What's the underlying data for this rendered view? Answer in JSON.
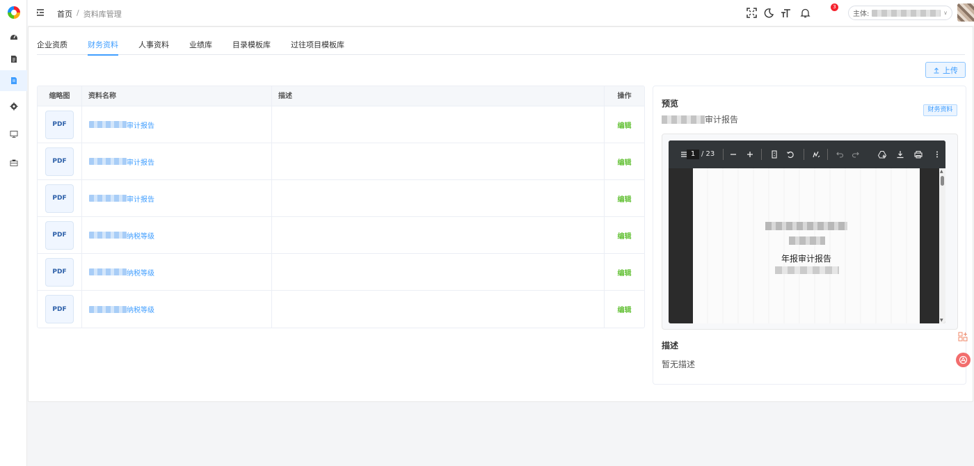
{
  "header": {
    "breadcrumb": {
      "home": "首页",
      "separator": "/",
      "current": "资料库管理"
    },
    "notification_count": "3",
    "entity_label": "主体:"
  },
  "tabs": [
    {
      "label": "企业资质",
      "active": false
    },
    {
      "label": "财务资料",
      "active": true
    },
    {
      "label": "人事资料",
      "active": false
    },
    {
      "label": "业绩库",
      "active": false
    },
    {
      "label": "目录模板库",
      "active": false
    },
    {
      "label": "过往项目模板库",
      "active": false
    }
  ],
  "upload_label": "上传",
  "table": {
    "headers": {
      "thumb": "缩略图",
      "name": "资料名称",
      "desc": "描述",
      "op": "操作"
    },
    "rows": [
      {
        "thumb": "PDF",
        "name_suffix": "审计报告",
        "desc": "",
        "op": "编辑"
      },
      {
        "thumb": "PDF",
        "name_suffix": "审计报告",
        "desc": "",
        "op": "编辑"
      },
      {
        "thumb": "PDF",
        "name_suffix": "审计报告",
        "desc": "",
        "op": "编辑"
      },
      {
        "thumb": "PDF",
        "name_suffix": "纳税等级",
        "desc": "",
        "op": "编辑"
      },
      {
        "thumb": "PDF",
        "name_suffix": "纳税等级",
        "desc": "",
        "op": "编辑"
      },
      {
        "thumb": "PDF",
        "name_suffix": "纳税等级",
        "desc": "",
        "op": "编辑"
      }
    ]
  },
  "preview": {
    "title": "预览",
    "filename_suffix": "审计报告",
    "tag": "财务资料",
    "pdf": {
      "page": "1",
      "total": "/ 23",
      "doc_title": "年报审计报告"
    },
    "desc_title": "描述",
    "desc_text": "暂无描述"
  },
  "colors": {
    "primary": "#409eff",
    "success": "#67c23a",
    "danger": "#f5222d"
  }
}
